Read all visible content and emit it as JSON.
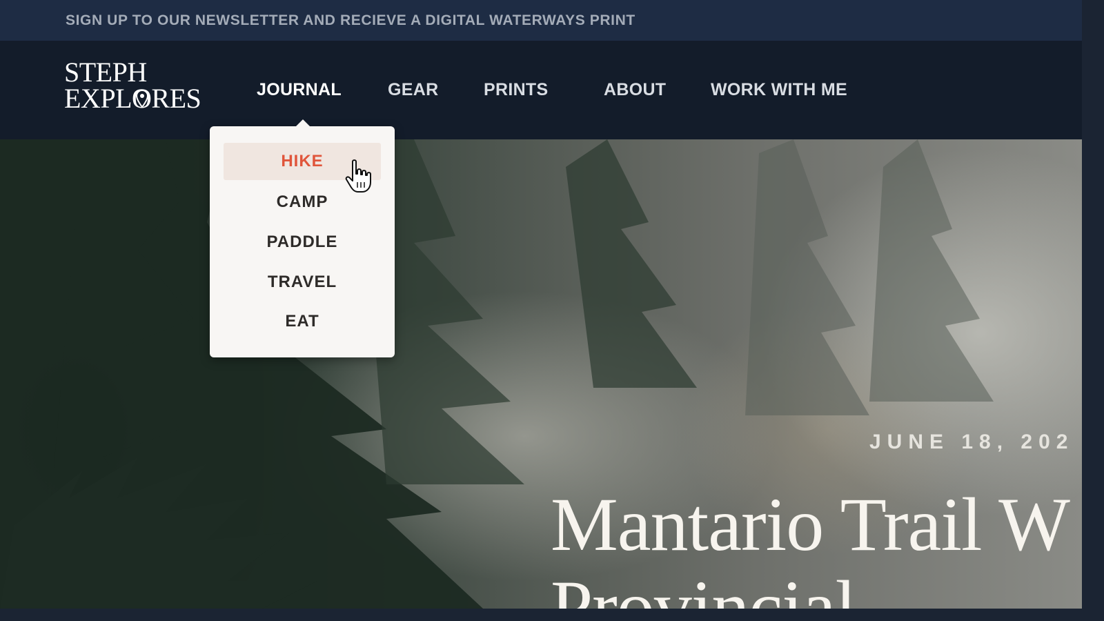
{
  "announcement": "SIGN UP TO OUR NEWSLETTER AND RECIEVE A DIGITAL WATERWAYS PRINT",
  "logo": {
    "line1": "STEPH",
    "line2": "EXPLORES"
  },
  "nav": {
    "items": [
      {
        "label": "JOURNAL",
        "active": true
      },
      {
        "label": "GEAR"
      },
      {
        "label": "PRINTS"
      },
      {
        "label": "ABOUT"
      },
      {
        "label": "WORK WITH ME"
      }
    ]
  },
  "dropdown": {
    "items": [
      {
        "label": "HIKE",
        "hovered": true
      },
      {
        "label": "CAMP"
      },
      {
        "label": "PADDLE"
      },
      {
        "label": "TRAVEL"
      },
      {
        "label": "EAT"
      }
    ]
  },
  "hero": {
    "date": "JUNE 18, 202",
    "title_line1": "Mantario Trail W",
    "title_line2": "Provincial"
  },
  "colors": {
    "announce_bg": "#1e2c44",
    "nav_bg": "#131c2a",
    "accent": "#e0553b",
    "dropdown_bg": "#f8f6f4",
    "hover_bg": "#f0e6e0"
  },
  "icons": {
    "cursor": "hand-pointer-icon",
    "logo_mark": "map-pin-icon"
  }
}
